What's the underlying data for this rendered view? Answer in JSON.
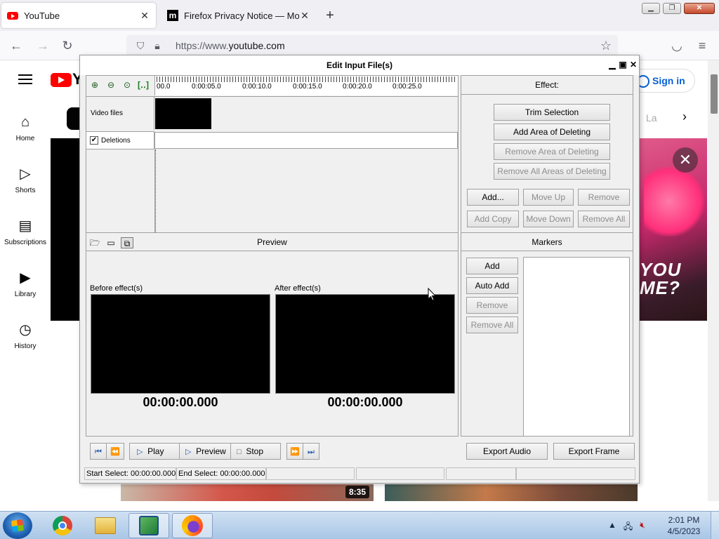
{
  "browser": {
    "tabs": [
      {
        "title": "YouTube",
        "active": true
      },
      {
        "title": "Firefox Privacy Notice — Mozilla",
        "active": false
      }
    ],
    "new_tab_symbol": "+",
    "url": {
      "prefix": "https://www.",
      "domain": "youtube.com"
    }
  },
  "youtube": {
    "sign_in_label": "Sign in",
    "sidebar": [
      {
        "label": "Home",
        "icon": "home-icon"
      },
      {
        "label": "Shorts",
        "icon": "shorts-icon"
      },
      {
        "label": "Subscriptions",
        "icon": "subscriptions-icon"
      },
      {
        "label": "Library",
        "icon": "library-icon"
      },
      {
        "label": "History",
        "icon": "history-icon"
      }
    ],
    "chip_partial": "La",
    "ad_text_line1": "YOU",
    "ad_text_line2": "ME?",
    "video_duration": "8:35"
  },
  "dialog": {
    "title": "Edit Input File(s)",
    "timeline": {
      "ruler_labels": [
        "00.0",
        "0:00:05.0",
        "0:00:10.0",
        "0:00:15.0",
        "0:00:20.0",
        "0:00:25.0"
      ],
      "tracks": {
        "video_files": "Video files",
        "deletions": "Deletions"
      },
      "deletions_checked": true
    },
    "effect": {
      "header": "Effect:",
      "buttons": {
        "trim_selection": "Trim Selection",
        "add_area": "Add Area of Deleting",
        "remove_area": "Remove Area of Deleting",
        "remove_all_areas": "Remove All Areas of Deleting",
        "add": "Add...",
        "move_up": "Move Up",
        "remove": "Remove",
        "add_copy": "Add Copy",
        "move_down": "Move Down",
        "remove_all": "Remove All"
      }
    },
    "preview": {
      "header": "Preview",
      "before_label": "Before effect(s)",
      "after_label": "After effect(s)",
      "before_time": "00:00:00.000",
      "after_time": "00:00:00.000"
    },
    "markers": {
      "header": "Markers",
      "buttons": {
        "add": "Add",
        "auto_add": "Auto Add",
        "remove": "Remove",
        "remove_all": "Remove All"
      }
    },
    "playback": {
      "play": "Play",
      "preview": "Preview",
      "stop": "Stop"
    },
    "export": {
      "audio": "Export Audio",
      "frame": "Export Frame"
    },
    "status": {
      "start_select": "Start Select: 00:00:00.000",
      "end_select": "End Select: 00:00:00.000"
    }
  },
  "taskbar": {
    "clock_time": "2:01 PM",
    "clock_date": "4/5/2023"
  }
}
